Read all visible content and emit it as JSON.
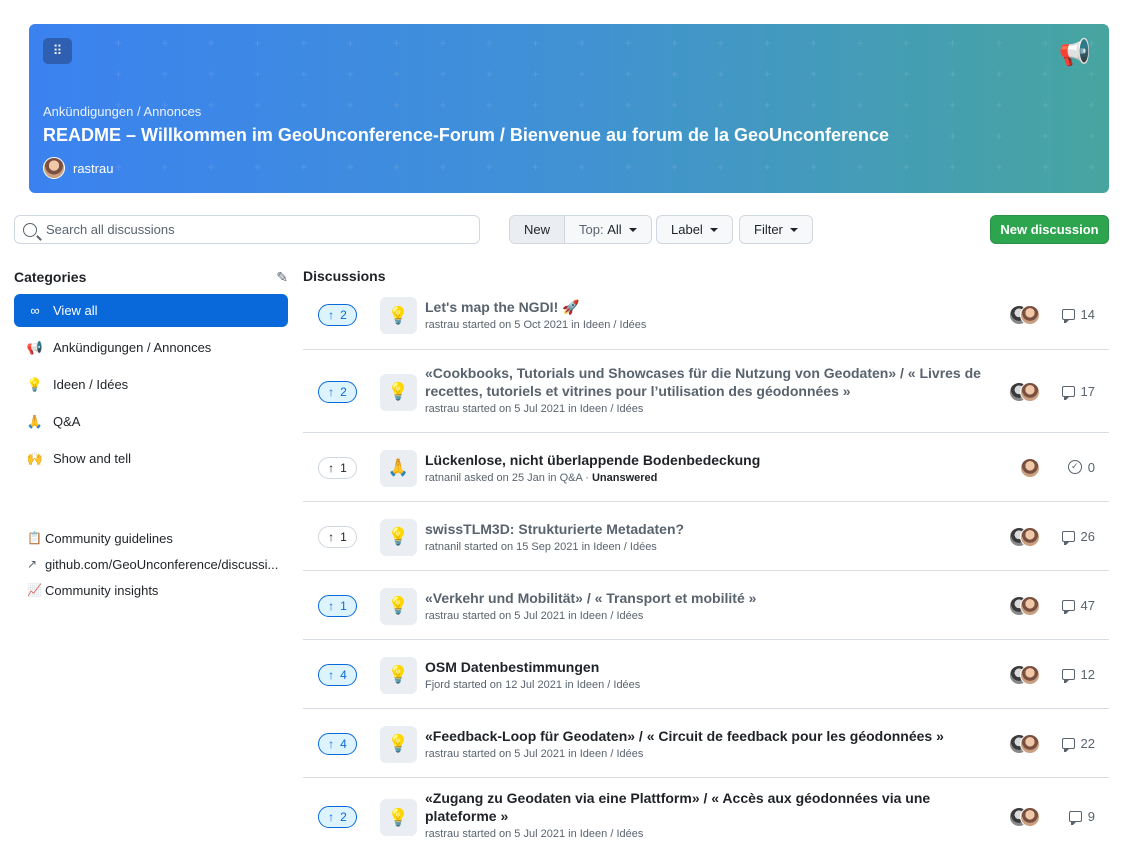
{
  "banner": {
    "category": "Ankündigungen / Annonces",
    "title": "README – Willkommen im GeoUnconference-Forum / Bienvenue au forum de la GeoUnconference",
    "author": "rastrau",
    "grip_icon": "⠿",
    "megaphone_icon": "📢",
    "gradient_from": "#3b82f0",
    "gradient_to": "#47a5a0"
  },
  "toolbar": {
    "search_placeholder": "Search all discussions",
    "sort_new": "New",
    "sort_top_label": "Top:",
    "sort_top_value": "All",
    "label_button": "Label",
    "filter_button": "Filter",
    "new_discussion": "New discussion",
    "accent": "#2da44e"
  },
  "sidebar": {
    "heading": "Categories",
    "categories": [
      {
        "icon": "∞",
        "label": "View all"
      },
      {
        "icon": "📢",
        "label": "Ankündigungen / Annonces"
      },
      {
        "icon": "💡",
        "label": "Ideen / Idées"
      },
      {
        "icon": "🙏",
        "label": "Q&A"
      },
      {
        "icon": "🙌",
        "label": "Show and tell"
      }
    ],
    "links": [
      {
        "icon": "📋",
        "label": "Community guidelines"
      },
      {
        "icon": "↗",
        "label": "github.com/GeoUnconference/discussi..."
      },
      {
        "icon": "📈",
        "label": "Community insights"
      }
    ]
  },
  "main": {
    "heading": "Discussions",
    "discussions": [
      {
        "votes": "2",
        "voted": true,
        "emoji": "💡",
        "title": "Let's map the NGDI! 🚀",
        "author": "rastrau",
        "verb": "started on",
        "date": "5 Oct 2021",
        "category": "Ideen / Idées",
        "status": "",
        "count": "14",
        "kind": "comments",
        "avatars": 2,
        "read": true
      },
      {
        "votes": "2",
        "voted": true,
        "emoji": "💡",
        "title": "«Cookbooks, Tutorials und Showcases für die Nutzung von Geodaten» / « Livres de recettes, tutoriels et vitrines pour l’utilisation des géodonnées »",
        "author": "rastrau",
        "verb": "started on",
        "date": "5 Jul 2021",
        "category": "Ideen / Idées",
        "status": "",
        "count": "17",
        "kind": "comments",
        "avatars": 2,
        "read": true
      },
      {
        "votes": "1",
        "voted": false,
        "emoji": "🙏",
        "title": "Lückenlose, nicht überlappende Bodenbedeckung",
        "author": "ratnanil",
        "verb": "asked on",
        "date": "25 Jan",
        "category": "Q&A",
        "status": "Unanswered",
        "count": "0",
        "kind": "answers",
        "avatars": 1,
        "read": false
      },
      {
        "votes": "1",
        "voted": false,
        "emoji": "💡",
        "title": "swissTLM3D: Strukturierte Metadaten?",
        "author": "ratnanil",
        "verb": "started on",
        "date": "15 Sep 2021",
        "category": "Ideen / Idées",
        "status": "",
        "count": "26",
        "kind": "comments",
        "avatars": 2,
        "read": true
      },
      {
        "votes": "1",
        "voted": true,
        "emoji": "💡",
        "title": "«Verkehr und Mobilität» / « Transport et mobilité »",
        "author": "rastrau",
        "verb": "started on",
        "date": "5 Jul 2021",
        "category": "Ideen / Idées",
        "status": "",
        "count": "47",
        "kind": "comments",
        "avatars": 2,
        "read": true
      },
      {
        "votes": "4",
        "voted": true,
        "emoji": "💡",
        "title": "OSM Datenbestimmungen",
        "author": "Fjord",
        "verb": "started on",
        "date": "12 Jul 2021",
        "category": "Ideen / Idées",
        "status": "",
        "count": "12",
        "kind": "comments",
        "avatars": 2,
        "read": false
      },
      {
        "votes": "4",
        "voted": true,
        "emoji": "💡",
        "title": "«Feedback-Loop für Geodaten» / « Circuit de feedback pour les géodonnées »",
        "author": "rastrau",
        "verb": "started on",
        "date": "5 Jul 2021",
        "category": "Ideen / Idées",
        "status": "",
        "count": "22",
        "kind": "comments",
        "avatars": 2,
        "read": false
      },
      {
        "votes": "2",
        "voted": true,
        "emoji": "💡",
        "title": "«Zugang zu Geodaten via eine Plattform» / « Accès aux géodonnées via une plateforme »",
        "author": "rastrau",
        "verb": "started on",
        "date": "5 Jul 2021",
        "category": "Ideen / Idées",
        "status": "",
        "count": "9",
        "kind": "comments",
        "avatars": 2,
        "read": false
      }
    ]
  }
}
